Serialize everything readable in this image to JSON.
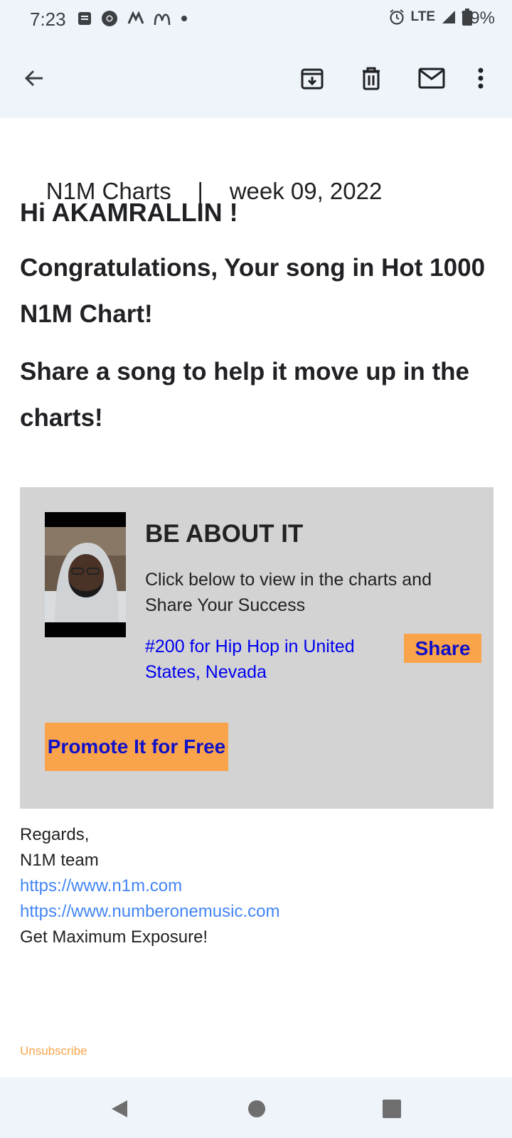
{
  "status": {
    "time": "7:23",
    "network": "LTE",
    "battery": "79%"
  },
  "email": {
    "header_brand": "N1M Charts",
    "header_sep": "|",
    "header_week": "week 09, 2022",
    "greeting": "Hi AKAMRALLIN !",
    "congrats": "Congratulations, Your song in Hot 1000 N1M Chart!",
    "share_msg": "Share a song to help it move up in the charts!",
    "card": {
      "song_title": "BE ABOUT IT",
      "description": "Click below to view in the charts and Share Your Success",
      "rank_link": "#200 for Hip Hop in United States, Nevada",
      "share_label": "Share",
      "promote_label": "Promote It for Free"
    },
    "signature": {
      "regards": "Regards,",
      "team": "N1M team",
      "link1": "https://www.n1m.com",
      "link2": "https://www.numberonemusic.com",
      "tagline": "Get Maximum Exposure!"
    },
    "unsubscribe": "Unsubscribe"
  },
  "icons": {
    "back": "arrow-left-icon",
    "archive": "archive-icon",
    "delete": "trash-icon",
    "mark_unread": "mail-icon",
    "more": "more-vert-icon"
  },
  "colors": {
    "accent_orange": "#f9a44a",
    "link_blue": "#4285f4",
    "card_bg": "#d3d3d3"
  }
}
